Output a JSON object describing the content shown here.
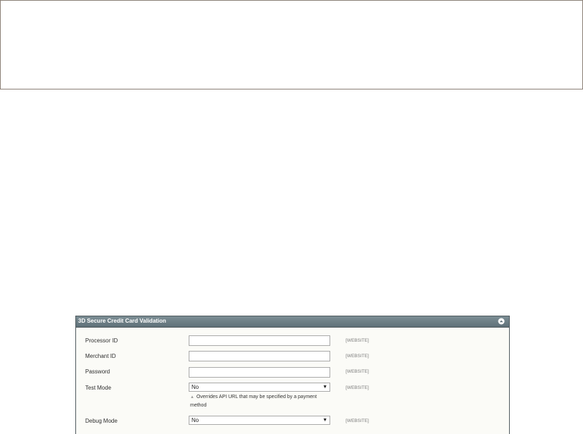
{
  "panel": {
    "title": "3D Secure Credit Card Validation",
    "collapse_icon": "collapse-up-icon"
  },
  "fields": {
    "processor_id": {
      "label": "Processor ID",
      "value": "",
      "scope": "[WEBSITE]"
    },
    "merchant_id": {
      "label": "Merchant ID",
      "value": "",
      "scope": "[WEBSITE]"
    },
    "password": {
      "label": "Password",
      "value": "",
      "scope": "[WEBSITE]"
    },
    "test_mode": {
      "label": "Test Mode",
      "value": "No",
      "scope": "[WEBSITE]",
      "note": "Overrides API URL that may be specified by a payment method"
    },
    "debug_mode": {
      "label": "Debug Mode",
      "value": "No",
      "scope": "[WEBSITE]"
    }
  }
}
